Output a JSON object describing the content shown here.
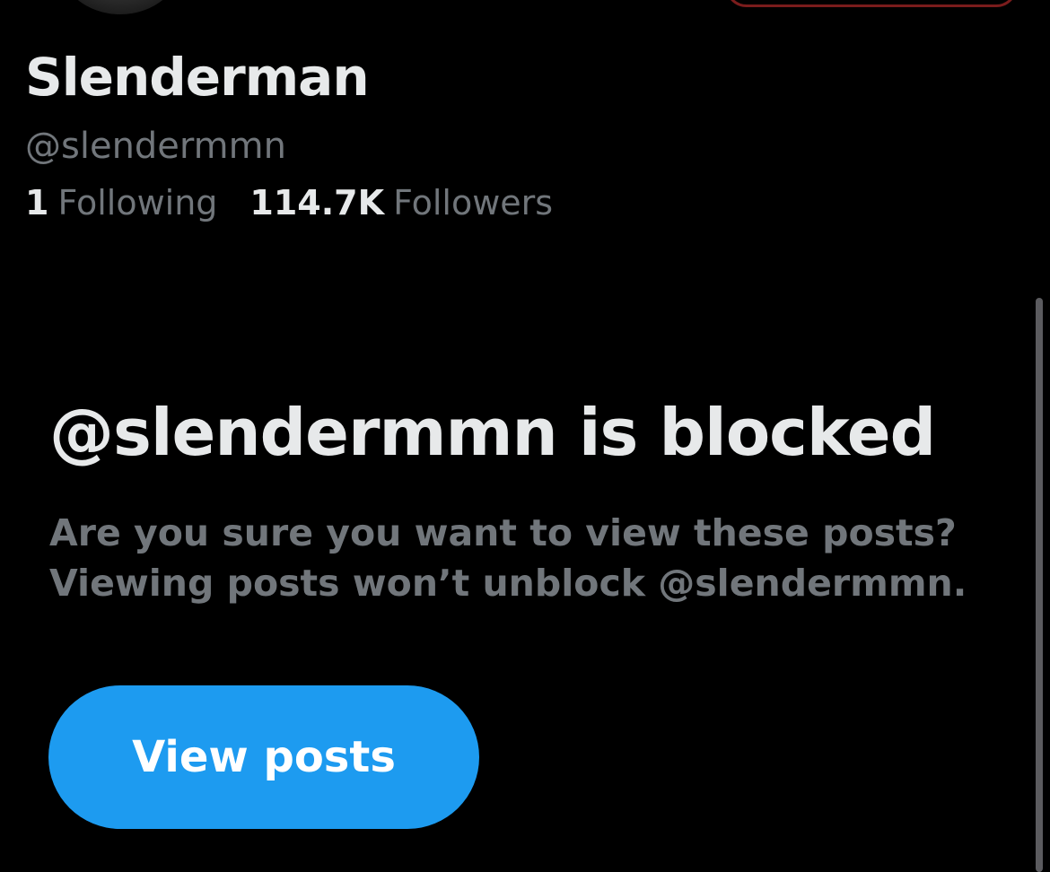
{
  "profile": {
    "display_name": "Slenderman",
    "handle": "@slendermmn",
    "following_count": "1",
    "following_label": "Following",
    "followers_count": "114.7K",
    "followers_label": "Followers"
  },
  "blocked_notice": {
    "title": "@slendermmn is blocked",
    "line1": "Are you sure you want to view these posts?",
    "line2": "Viewing posts won’t unblock @slendermmn.",
    "button_label": "View posts"
  },
  "colors": {
    "background": "#000000",
    "primary_text": "#e7e9ea",
    "secondary_text": "#71767b",
    "accent": "#1d9bf0",
    "blocked_outline": "#7a1c1c"
  }
}
